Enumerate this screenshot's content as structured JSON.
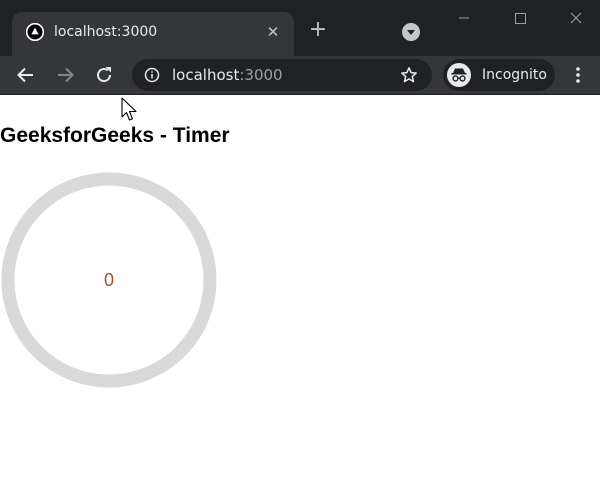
{
  "browser": {
    "tab": {
      "title": "localhost:3000",
      "favicon": "vercel-triangle-icon"
    },
    "omnibox": {
      "host": "localhost",
      "port": ":3000"
    },
    "incognito_label": "Incognito"
  },
  "page": {
    "title": "GeeksforGeeks - Timer",
    "timer": {
      "value": "0",
      "progress": 0,
      "track_color": "#d9d9d9",
      "text_color": "#a0522d"
    }
  },
  "colors": {
    "titlebar": "#202124",
    "toolbar": "#35363a",
    "omnibox": "#202124",
    "text_light": "#e8eaed"
  }
}
